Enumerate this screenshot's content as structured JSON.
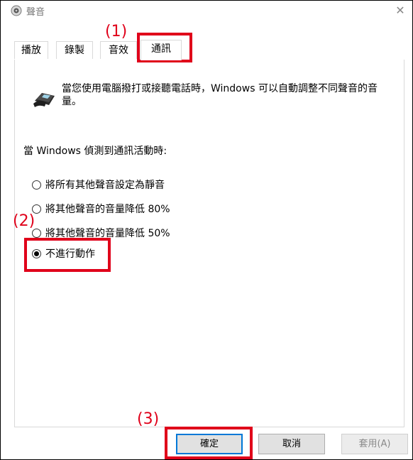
{
  "window": {
    "title": "聲音",
    "close_glyph": "✕"
  },
  "tabs": [
    {
      "label": "播放",
      "active": false
    },
    {
      "label": "錄製",
      "active": false
    },
    {
      "label": "音效",
      "active": false
    },
    {
      "label": "通訊",
      "active": true
    }
  ],
  "communications": {
    "description": "當您使用電腦撥打或接聽電話時，Windows 可以自動調整不同聲音的音量。",
    "detect_label": "當 Windows 偵測到通訊活動時:",
    "options": [
      {
        "label": "將所有其他聲音設定為靜音",
        "checked": false
      },
      {
        "label": "將其他聲音的音量降低 80%",
        "checked": false
      },
      {
        "label": "將其他聲音的音量降低 50%",
        "checked": false
      },
      {
        "label": "不進行動作",
        "checked": true
      }
    ]
  },
  "buttons": {
    "ok": "確定",
    "cancel": "取消",
    "apply": "套用(A)"
  },
  "annotations": {
    "step1": "(1)",
    "step2": "(2)",
    "step3": "(3)",
    "color": "#e0001a"
  },
  "icons": {
    "window": "speaker-icon",
    "phone": "telephone-icon",
    "close": "close-icon"
  }
}
